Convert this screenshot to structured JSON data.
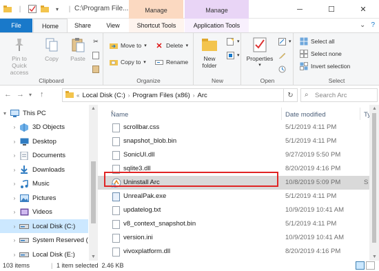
{
  "title_bar": {
    "path": "C:\\Program File...",
    "manage_1": "Manage",
    "manage_2": "Manage"
  },
  "tabs": {
    "file": "File",
    "home": "Home",
    "share": "Share",
    "view": "View",
    "shortcut_tools": "Shortcut Tools",
    "application_tools": "Application Tools"
  },
  "ribbon": {
    "clipboard": {
      "pin": "Pin to Quick access",
      "copy": "Copy",
      "paste": "Paste",
      "label": "Clipboard"
    },
    "organize": {
      "move_to": "Move to",
      "copy_to": "Copy to",
      "delete": "Delete",
      "rename": "Rename",
      "label": "Organize"
    },
    "new": {
      "new_folder": "New folder",
      "label": "New"
    },
    "open": {
      "properties": "Properties",
      "label": "Open"
    },
    "select": {
      "select_all": "Select all",
      "select_none": "Select none",
      "invert": "Invert selection",
      "label": "Select"
    }
  },
  "address": {
    "prefix": "«",
    "crumbs": [
      "Local Disk (C:)",
      "Program Files (x86)",
      "Arc"
    ],
    "search_placeholder": "Search Arc"
  },
  "nav": [
    {
      "label": "This PC",
      "icon": "computer-icon",
      "expand": "▾"
    },
    {
      "label": "3D Objects",
      "icon": "cube-icon",
      "expand": "›"
    },
    {
      "label": "Desktop",
      "icon": "desktop-icon",
      "expand": "›"
    },
    {
      "label": "Documents",
      "icon": "documents-icon",
      "expand": "›"
    },
    {
      "label": "Downloads",
      "icon": "download-icon",
      "expand": "›"
    },
    {
      "label": "Music",
      "icon": "music-icon",
      "expand": "›"
    },
    {
      "label": "Pictures",
      "icon": "pictures-icon",
      "expand": "›"
    },
    {
      "label": "Videos",
      "icon": "videos-icon",
      "expand": "›"
    },
    {
      "label": "Local Disk (C:)",
      "icon": "drive-icon",
      "expand": "›"
    },
    {
      "label": "System Reserved (",
      "icon": "drive-icon",
      "expand": "›"
    },
    {
      "label": "Local Disk (E:)",
      "icon": "drive-icon",
      "expand": "›"
    }
  ],
  "columns": {
    "name": "Name",
    "date_modified": "Date modified",
    "type": "Ty"
  },
  "files": [
    {
      "name": "scrollbar.css",
      "date": "5/1/2019 4:11 PM",
      "type": "",
      "kind": "file"
    },
    {
      "name": "snapshot_blob.bin",
      "date": "5/1/2019 4:11 PM",
      "type": "",
      "kind": "file"
    },
    {
      "name": "SonicUI.dll",
      "date": "9/27/2019 5:50 PM",
      "type": "",
      "kind": "file"
    },
    {
      "name": "sqlite3.dll",
      "date": "8/20/2019 4:16 PM",
      "type": "",
      "kind": "file"
    },
    {
      "name": "Uninstall Arc",
      "date": "10/8/2019 5:09 PM",
      "type": "S",
      "kind": "shortcut"
    },
    {
      "name": "UnrealPak.exe",
      "date": "5/1/2019 4:11 PM",
      "type": "",
      "kind": "exe"
    },
    {
      "name": "updatelog.txt",
      "date": "10/9/2019 10:41 AM",
      "type": "",
      "kind": "file"
    },
    {
      "name": "v8_context_snapshot.bin",
      "date": "5/1/2019 4:11 PM",
      "type": "",
      "kind": "file"
    },
    {
      "name": "version.ini",
      "date": "10/9/2019 10:41 AM",
      "type": "",
      "kind": "file"
    },
    {
      "name": "vivoxplatform.dll",
      "date": "8/20/2019 4:16 PM",
      "type": "",
      "kind": "file"
    }
  ],
  "status": {
    "item_count": "103 items",
    "selection": "1 item selected  2.46 KB"
  },
  "colors": {
    "file_tab": "#1979ca",
    "selection_nav": "#cce8ff",
    "highlight_box": "#e02424",
    "manage_orange": "#fbd9c1",
    "manage_purple": "#e9d5f6"
  }
}
